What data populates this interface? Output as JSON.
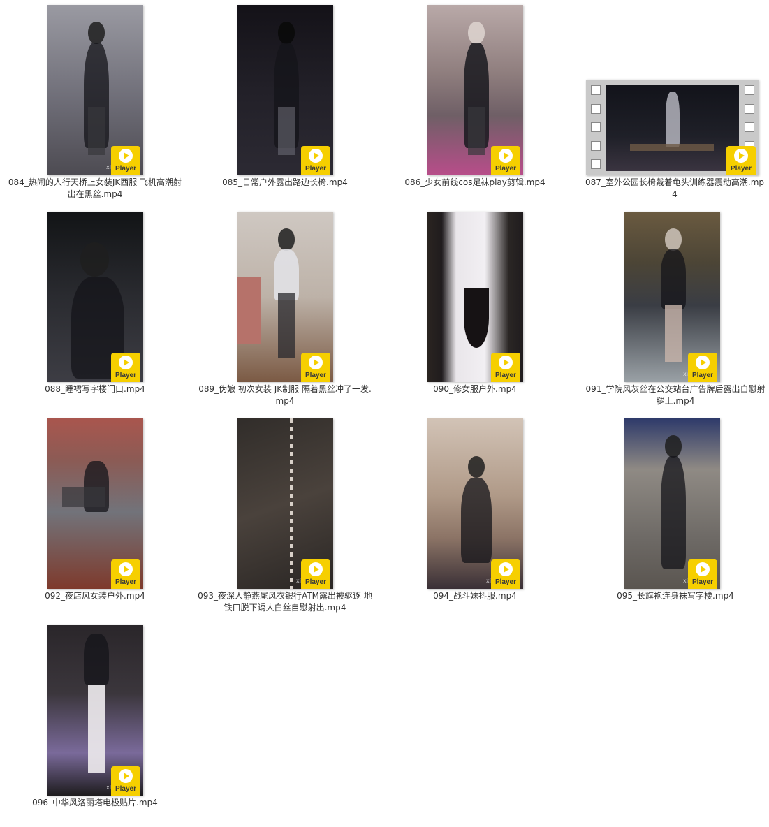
{
  "items": [
    {
      "caption": "084_热闹的人行天桥上女装JK西服 飞机高潮射出在黑丝.mp4",
      "badge": "Player",
      "watermark": "xix",
      "colors": [
        "#9a9aa2",
        "#6f6e78",
        "#4d4b52"
      ]
    },
    {
      "caption": "085_日常户外露出路边长椅.mp4",
      "badge": "Player",
      "watermark": "",
      "colors": [
        "#141218",
        "#222028",
        "#2c2a33"
      ]
    },
    {
      "caption": "086_少女前线cos足袜play剪辑.mp4",
      "badge": "Player",
      "watermark": "",
      "colors": [
        "#b9a9a8",
        "#6f5f66",
        "#b84d8a"
      ]
    },
    {
      "caption": "087_室外公园长椅戴着龟头训练器震动高潮.mp4",
      "badge": "Player",
      "watermark": "",
      "colors": [
        "#12131a",
        "#2a2a32",
        "#4b4656"
      ]
    },
    {
      "caption": "088_睡裙写字楼门口.mp4",
      "badge": "Player",
      "watermark": "",
      "colors": [
        "#121416",
        "#2a2b30",
        "#3d3d44"
      ]
    },
    {
      "caption": "089_伪娘 初次女装 JK制服 隔着黑丝冲了一发.mp4",
      "badge": "Player",
      "watermark": "",
      "colors": [
        "#cfc8c2",
        "#b89a86",
        "#7b5a44"
      ]
    },
    {
      "caption": "090_修女服户外.mp4",
      "badge": "Player",
      "watermark": "",
      "colors": [
        "#2a2420",
        "#e9e6ea",
        "#201c1e"
      ]
    },
    {
      "caption": "091_学院风灰丝在公交站台广告牌后露出自慰射腿上.mp4",
      "badge": "Player",
      "watermark": "xix",
      "colors": [
        "#6a5a40",
        "#3a3d44",
        "#9aa1a6"
      ]
    },
    {
      "caption": "092_夜店风女装户外.mp4",
      "badge": "Player",
      "watermark": "",
      "colors": [
        "#a9564e",
        "#72737a",
        "#7e3a2c"
      ]
    },
    {
      "caption": "093_夜深人静燕尾风衣银行ATM露出被驱逐 地铁口脱下诱人白丝自慰射出.mp4",
      "badge": "Player",
      "watermark": "xix",
      "colors": [
        "#312d2a",
        "#4a423c",
        "#2a2624"
      ]
    },
    {
      "caption": "094_战斗妹抖服.mp4",
      "badge": "Player",
      "watermark": "xix",
      "colors": [
        "#d2c3b6",
        "#8c7466",
        "#3a3036"
      ]
    },
    {
      "caption": "095_长旗袍连身袜写字楼.mp4",
      "badge": "Player",
      "watermark": "xix",
      "colors": [
        "#2e3a6a",
        "#8f8a84",
        "#5a5550"
      ]
    },
    {
      "caption": "096_中华风洛丽塔电极贴片.mp4",
      "badge": "Player",
      "watermark": "xix",
      "colors": [
        "#2a262a",
        "#e6e3e6",
        "#7a6a9a"
      ]
    }
  ]
}
